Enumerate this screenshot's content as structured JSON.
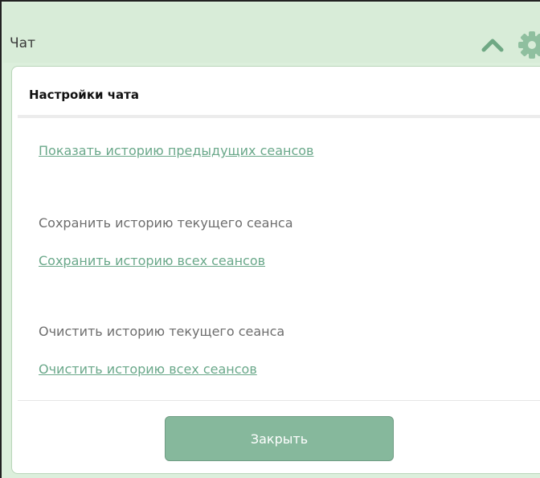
{
  "chat": {
    "title": "Чат"
  },
  "settings": {
    "title": "Настройки чата",
    "show_history_link": "Показать историю предыдущих сеансов",
    "save_current_text": "Сохранить историю текущего сеанса",
    "save_all_link": "Сохранить историю всех сеансов",
    "clear_current_text": "Очистить историю текущего сеанса",
    "clear_all_link": "Очистить историю всех сеансов",
    "close_label": "Закрыть"
  },
  "icons": {
    "collapse": "chevron-up-icon",
    "settings": "gear-icon"
  },
  "colors": {
    "header_bg": "#d8ecd8",
    "link": "#6aa88a",
    "button_bg": "#86b89c"
  }
}
